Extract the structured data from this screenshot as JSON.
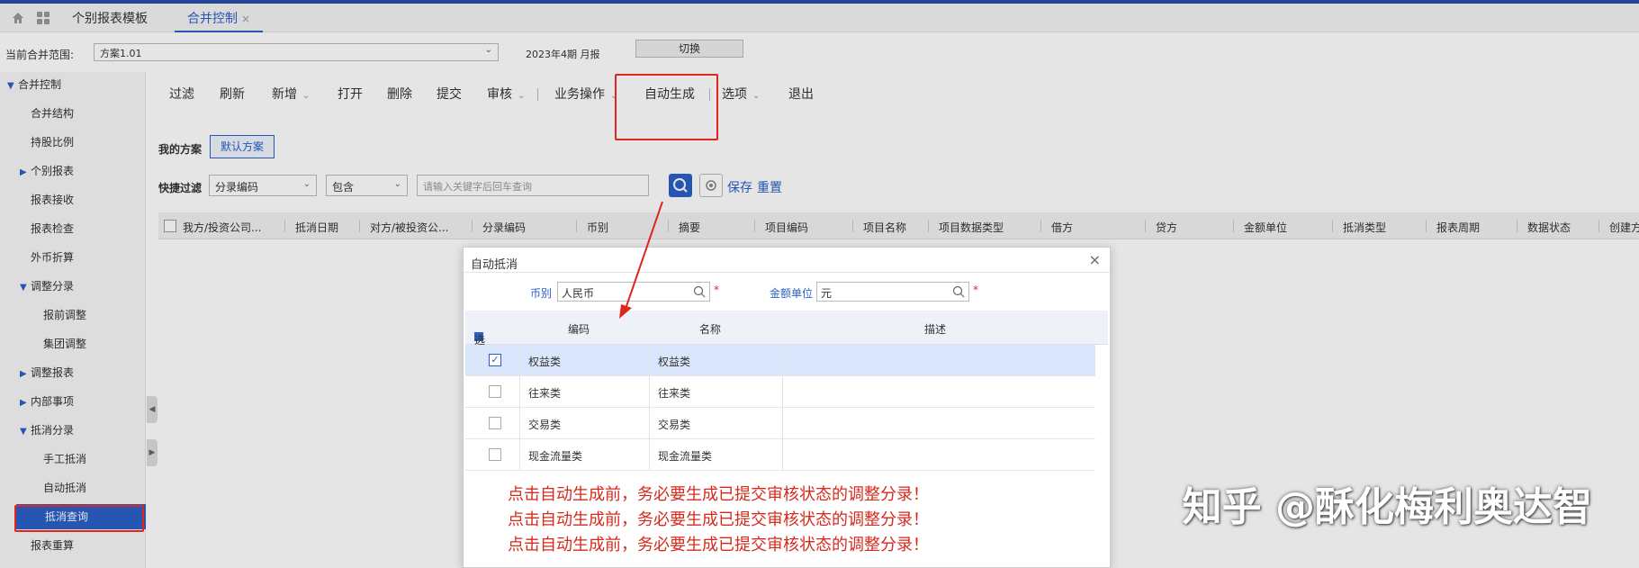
{
  "tabs": {
    "tab1": "个别报表模板",
    "tab2": "合并控制",
    "close": "×"
  },
  "scope": {
    "label": "当前合并范围:",
    "value": "方案1.01",
    "period": "2023年4期 月报",
    "switch": "切换"
  },
  "sidebar": {
    "items": [
      {
        "label": "合并控制",
        "arrow": "▼"
      },
      {
        "label": "合并结构",
        "arrow": ""
      },
      {
        "label": "持股比例",
        "arrow": ""
      },
      {
        "label": "个别报表",
        "arrow": "▶"
      },
      {
        "label": "报表接收",
        "arrow": ""
      },
      {
        "label": "报表检查",
        "arrow": ""
      },
      {
        "label": "外币折算",
        "arrow": ""
      },
      {
        "label": "调整分录",
        "arrow": "▼"
      },
      {
        "label": "报前调整",
        "arrow": ""
      },
      {
        "label": "集团调整",
        "arrow": ""
      },
      {
        "label": "调整报表",
        "arrow": "▶"
      },
      {
        "label": "内部事项",
        "arrow": "▶"
      },
      {
        "label": "抵消分录",
        "arrow": "▼"
      },
      {
        "label": "手工抵消",
        "arrow": ""
      },
      {
        "label": "自动抵消",
        "arrow": ""
      },
      {
        "label": "抵消查询",
        "arrow": ""
      },
      {
        "label": "报表重算",
        "arrow": ""
      }
    ]
  },
  "toolbar": {
    "filter": "过滤",
    "refresh": "刷新",
    "add": "新增",
    "open": "打开",
    "delete": "删除",
    "submit": "提交",
    "audit": "审核",
    "business": "业务操作",
    "autogen": "自动生成",
    "options": "选项",
    "exit": "退出"
  },
  "scheme": {
    "label": "我的方案",
    "default": "默认方案"
  },
  "quickfilter": {
    "label": "快捷过滤",
    "field": "分录编码",
    "op": "包含",
    "placeholder": "请输入关键字后回车查询",
    "save": "保存",
    "reset": "重置"
  },
  "columns": [
    "我方/投资公司...",
    "抵消日期",
    "对方/被投资公...",
    "分录编码",
    "币别",
    "摘要",
    "项目编码",
    "项目名称",
    "项目数据类型",
    "借方",
    "贷方",
    "金额单位",
    "抵消类型",
    "报表周期",
    "数据状态",
    "创建方"
  ],
  "dialog": {
    "title": "自动抵消",
    "close": "×",
    "currency_label": "币别",
    "currency_value": "人民币",
    "unit_label": "金额单位",
    "unit_value": "元",
    "required": "*",
    "headers": {
      "select": "选择",
      "code": "编码",
      "name": "名称",
      "desc": "描述"
    },
    "rows": [
      {
        "code": "权益类",
        "name": "权益类",
        "checked": true
      },
      {
        "code": "往来类",
        "name": "往来类",
        "checked": false
      },
      {
        "code": "交易类",
        "name": "交易类",
        "checked": false
      },
      {
        "code": "现金流量类",
        "name": "现金流量类",
        "checked": false
      }
    ],
    "check_mark": "✓"
  },
  "notes": [
    "点击自动生成前，务必要生成已提交审核状态的调整分录！",
    "点击自动生成前，务必要生成已提交审核状态的调整分录！",
    "点击自动生成前，务必要生成已提交审核状态的调整分录！"
  ],
  "watermark": "知乎 @酥化梅利奥达智",
  "colors": {
    "accent": "#2b5fc7",
    "highlight": "#e0261b"
  }
}
